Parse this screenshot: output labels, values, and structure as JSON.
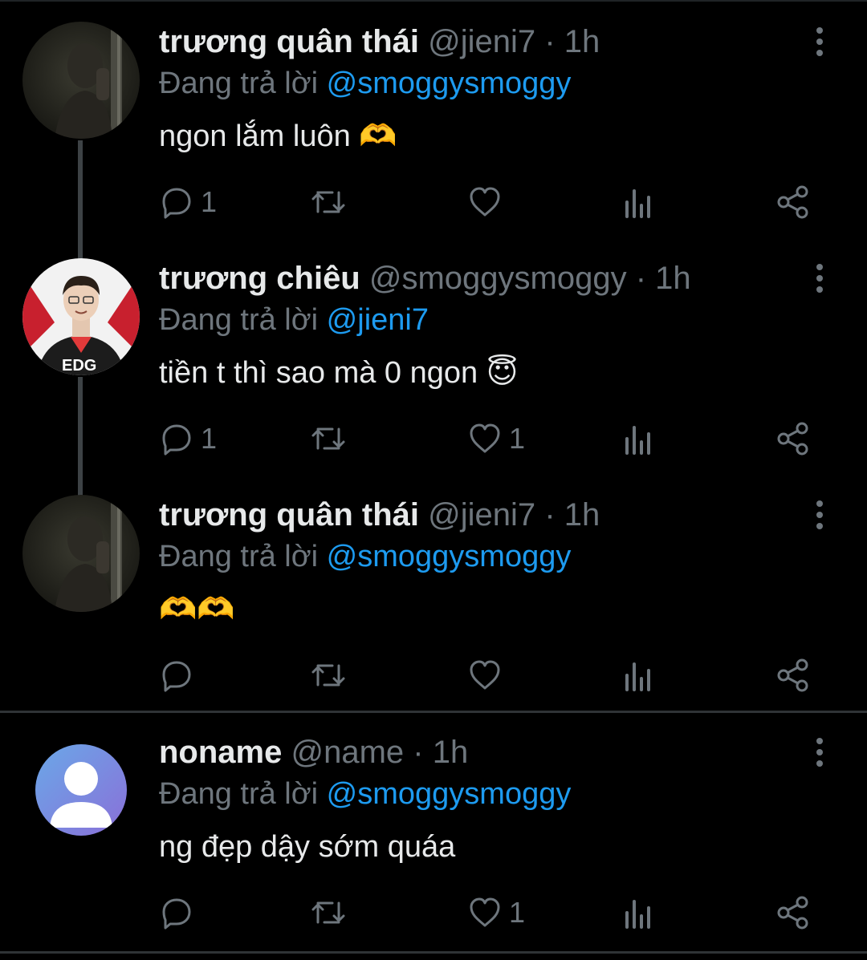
{
  "tweets": [
    {
      "name": "trương quân thái",
      "handle": "@jieni7",
      "time": "· 1h",
      "reply_prefix": "Đang trả lời",
      "reply_to": "@smoggysmoggy",
      "text": "ngon lắm luôn 🫶",
      "reply_count": "1",
      "retweet_count": "",
      "like_count": ""
    },
    {
      "name": "trương chiêu",
      "handle": "@smoggysmoggy",
      "time": "· 1h",
      "reply_prefix": "Đang trả lời",
      "reply_to": "@jieni7",
      "text": "tiền t thì sao mà 0 ngon 😇",
      "avatar_jersey_text": "EDG",
      "reply_count": "1",
      "retweet_count": "",
      "like_count": "1"
    },
    {
      "name": "trương quân thái",
      "handle": "@jieni7",
      "time": "· 1h",
      "reply_prefix": "Đang trả lời",
      "reply_to": "@smoggysmoggy",
      "text": "🫶🫶",
      "reply_count": "",
      "retweet_count": "",
      "like_count": ""
    },
    {
      "name": "noname",
      "handle": "@name",
      "time": "· 1h",
      "reply_prefix": "Đang trả lời",
      "reply_to": "@smoggysmoggy",
      "text": "ng đẹp dậy sớm quáa",
      "reply_count": "",
      "retweet_count": "",
      "like_count": "1"
    }
  ],
  "icons": {
    "reply": "reply-icon",
    "retweet": "retweet-icon",
    "like": "heart-icon",
    "views": "analytics-icon",
    "share": "share-icon",
    "more": "more-vertical-icon"
  },
  "colors": {
    "background": "#000000",
    "text": "#e7e9ea",
    "muted": "#6e767d",
    "mention": "#1d9bf0",
    "thread_line": "#3d4245",
    "divider": "#2f3336"
  }
}
